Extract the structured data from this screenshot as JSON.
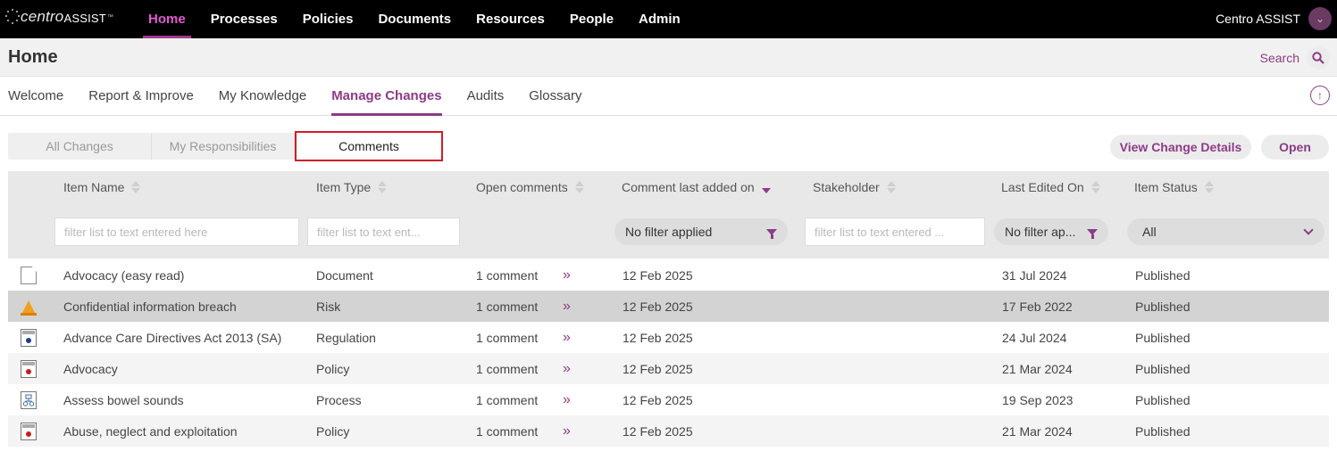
{
  "app": {
    "logo_text_1": "centro",
    "logo_text_2": "ASSIST",
    "logo_tm": "™",
    "nav": [
      "Home",
      "Processes",
      "Policies",
      "Documents",
      "Resources",
      "People",
      "Admin"
    ],
    "active_nav": "Home",
    "user_name": "Centro ASSIST",
    "avatar_glyph": "⌄"
  },
  "page": {
    "title": "Home",
    "search_label": "Search",
    "search_glyph": "🔍",
    "tabs": [
      "Welcome",
      "Report & Improve",
      "My Knowledge",
      "Manage Changes",
      "Audits",
      "Glossary"
    ],
    "active_tab": "Manage Changes",
    "upload_glyph": "↑"
  },
  "toolbar": {
    "segments": [
      "All Changes",
      "My Responsibilities",
      "Comments"
    ],
    "active_segment": "Comments",
    "view_button": "View Change Details",
    "open_button": "Open"
  },
  "table": {
    "columns": [
      "Item Name",
      "Item Type",
      "Open comments",
      "Comment last added on",
      "Stakeholder",
      "Last Edited On",
      "Item Status"
    ],
    "sorted_column": "Comment last added on",
    "filters": {
      "item_name_placeholder": "filter list to text entered here",
      "item_type_placeholder": "filter list to text ent...",
      "comment_date_filter": "No filter applied",
      "stakeholder_placeholder": "filter list to text entered ...",
      "last_edited_filter": "No filter ap...",
      "status_selected": "All"
    },
    "rows": [
      {
        "icon": "document-icon",
        "name": "Advocacy (easy read)",
        "type": "Document",
        "comments": "1 comment",
        "added": "12 Feb 2025",
        "stakeholder": "",
        "edited": "31 Jul 2024",
        "status": "Published",
        "selected": false
      },
      {
        "icon": "risk-cone-icon",
        "name": "Confidential information breach",
        "type": "Risk",
        "comments": "1 comment",
        "added": "12 Feb 2025",
        "stakeholder": "",
        "edited": "17 Feb 2022",
        "status": "Published",
        "selected": true
      },
      {
        "icon": "regulation-icon",
        "name": "Advance Care Directives Act 2013 (SA)",
        "type": "Regulation",
        "comments": "1 comment",
        "added": "12 Feb 2025",
        "stakeholder": "",
        "edited": "24 Jul 2024",
        "status": "Published",
        "selected": false
      },
      {
        "icon": "policy-icon",
        "name": "Advocacy",
        "type": "Policy",
        "comments": "1 comment",
        "added": "12 Feb 2025",
        "stakeholder": "",
        "edited": "21 Mar 2024",
        "status": "Published",
        "selected": false
      },
      {
        "icon": "process-icon",
        "name": "Assess bowel sounds",
        "type": "Process",
        "comments": "1 comment",
        "added": "12 Feb 2025",
        "stakeholder": "",
        "edited": "19 Sep 2023",
        "status": "Published",
        "selected": false
      },
      {
        "icon": "policy-icon",
        "name": "Abuse, neglect and exploitation",
        "type": "Policy",
        "comments": "1 comment",
        "added": "12 Feb 2025",
        "stakeholder": "",
        "edited": "21 Mar 2024",
        "status": "Published",
        "selected": false
      }
    ],
    "more_glyph": "»"
  },
  "colors": {
    "brand": "#8d3b87",
    "active_nav": "#e05ad0",
    "highlight_border": "#cc1f28"
  }
}
